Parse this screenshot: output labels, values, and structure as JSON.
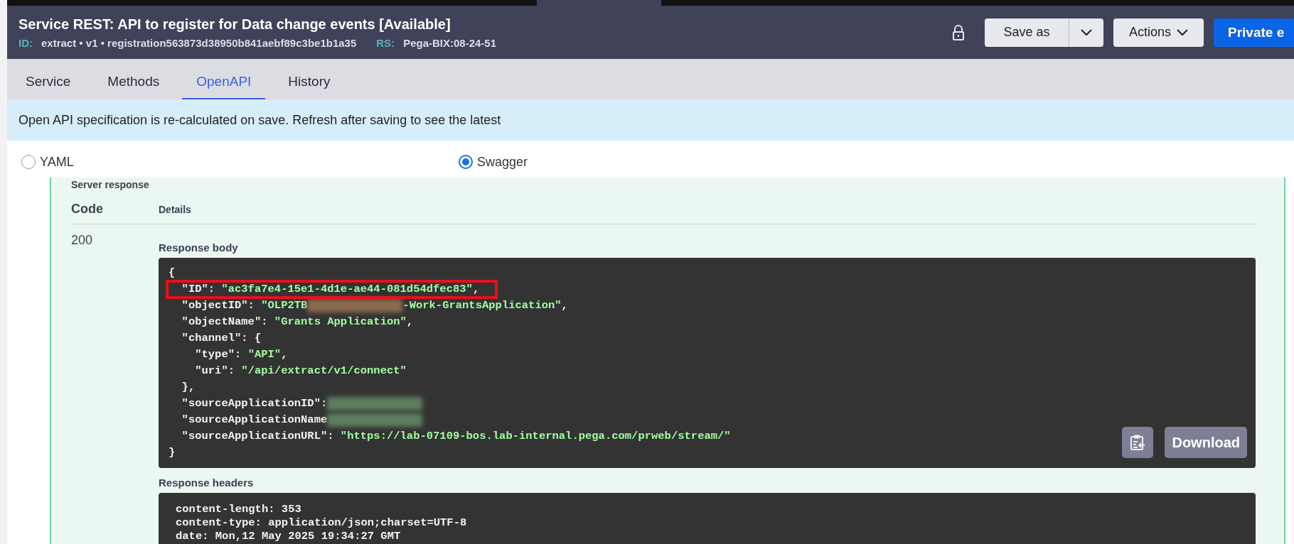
{
  "header": {
    "title": "Service REST: API to register for Data change events [Available]",
    "id_label": "ID:",
    "id_value": "extract • v1 • registration563873d38950b841aebf89c3be1b1a35",
    "rs_label": "RS:",
    "rs_value": "Pega-BIX:08-24-51",
    "buttons": [
      {
        "kind": "split",
        "label": "Save as"
      },
      {
        "kind": "menu",
        "label": "Actions"
      },
      {
        "kind": "primary",
        "label": "Private e"
      }
    ]
  },
  "tabs": [
    {
      "label": "Service",
      "selected": false
    },
    {
      "label": "Methods",
      "selected": false
    },
    {
      "label": "OpenAPI",
      "selected": true
    },
    {
      "label": "History",
      "selected": false
    }
  ],
  "banner": "Open API specification is re-calculated on save. Refresh after saving to see the latest",
  "format_options": [
    {
      "label": "YAML",
      "selected": false
    },
    {
      "label": "Swagger",
      "selected": true
    }
  ],
  "server_response": {
    "title": "Server response",
    "columns": [
      "Code",
      "Details"
    ],
    "code": "200",
    "body_title": "Response body",
    "body_lines": [
      {
        "highlighted": false,
        "tokens": [
          {
            "kind": "punct",
            "text": "{"
          }
        ]
      },
      {
        "highlighted": true,
        "tokens": [
          {
            "kind": "key",
            "text": "  \"ID\": "
          },
          {
            "kind": "string",
            "text": "\"ac3fa7e4-15e1-4d1e-ae44-081d54dfec83\""
          },
          {
            "kind": "punct",
            "text": ","
          }
        ]
      },
      {
        "highlighted": false,
        "tokens": [
          {
            "kind": "key",
            "text": "  \"objectID\": "
          },
          {
            "kind": "string",
            "text": "\"OLP2TB"
          },
          {
            "kind": "redacted",
            "color": "#8a6a4e"
          },
          {
            "kind": "string",
            "text": "-Work-GrantsApplication\""
          },
          {
            "kind": "punct",
            "text": ","
          }
        ]
      },
      {
        "highlighted": false,
        "tokens": [
          {
            "kind": "key",
            "text": "  \"objectName\": "
          },
          {
            "kind": "string",
            "text": "\"Grants Application\""
          },
          {
            "kind": "punct",
            "text": ","
          }
        ]
      },
      {
        "highlighted": false,
        "tokens": [
          {
            "kind": "key",
            "text": "  \"channel\": {"
          }
        ]
      },
      {
        "highlighted": false,
        "tokens": [
          {
            "kind": "key",
            "text": "    \"type\": "
          },
          {
            "kind": "string",
            "text": "\"API\""
          },
          {
            "kind": "punct",
            "text": ","
          }
        ]
      },
      {
        "highlighted": false,
        "tokens": [
          {
            "kind": "key",
            "text": "    \"uri\": "
          },
          {
            "kind": "string",
            "text": "\"/api/extract/v1/connect\""
          }
        ]
      },
      {
        "highlighted": false,
        "tokens": [
          {
            "kind": "punct",
            "text": "  },"
          }
        ]
      },
      {
        "highlighted": false,
        "tokens": [
          {
            "kind": "key",
            "text": "  \"sourceApplicationID\":"
          },
          {
            "kind": "redacted",
            "color": "#5d7d5e"
          }
        ]
      },
      {
        "highlighted": false,
        "tokens": [
          {
            "kind": "key",
            "text": "  \"sourceApplicationName"
          },
          {
            "kind": "redacted",
            "color": "#5d7d5e"
          }
        ]
      },
      {
        "highlighted": false,
        "tokens": [
          {
            "kind": "key",
            "text": "  \"sourceApplicationURL\": "
          },
          {
            "kind": "string",
            "text": "\"https://lab-07109-bos.lab-internal.pega.com/prweb/stream/\""
          }
        ]
      },
      {
        "highlighted": false,
        "tokens": [
          {
            "kind": "punct",
            "text": "}"
          }
        ]
      }
    ],
    "download_label": "Download",
    "headers_title": "Response headers",
    "header_lines": [
      "content-length: 353",
      "content-type: application/json;charset=UTF-8",
      "date: Mon,12 May 2025 19:34:27 GMT"
    ]
  }
}
